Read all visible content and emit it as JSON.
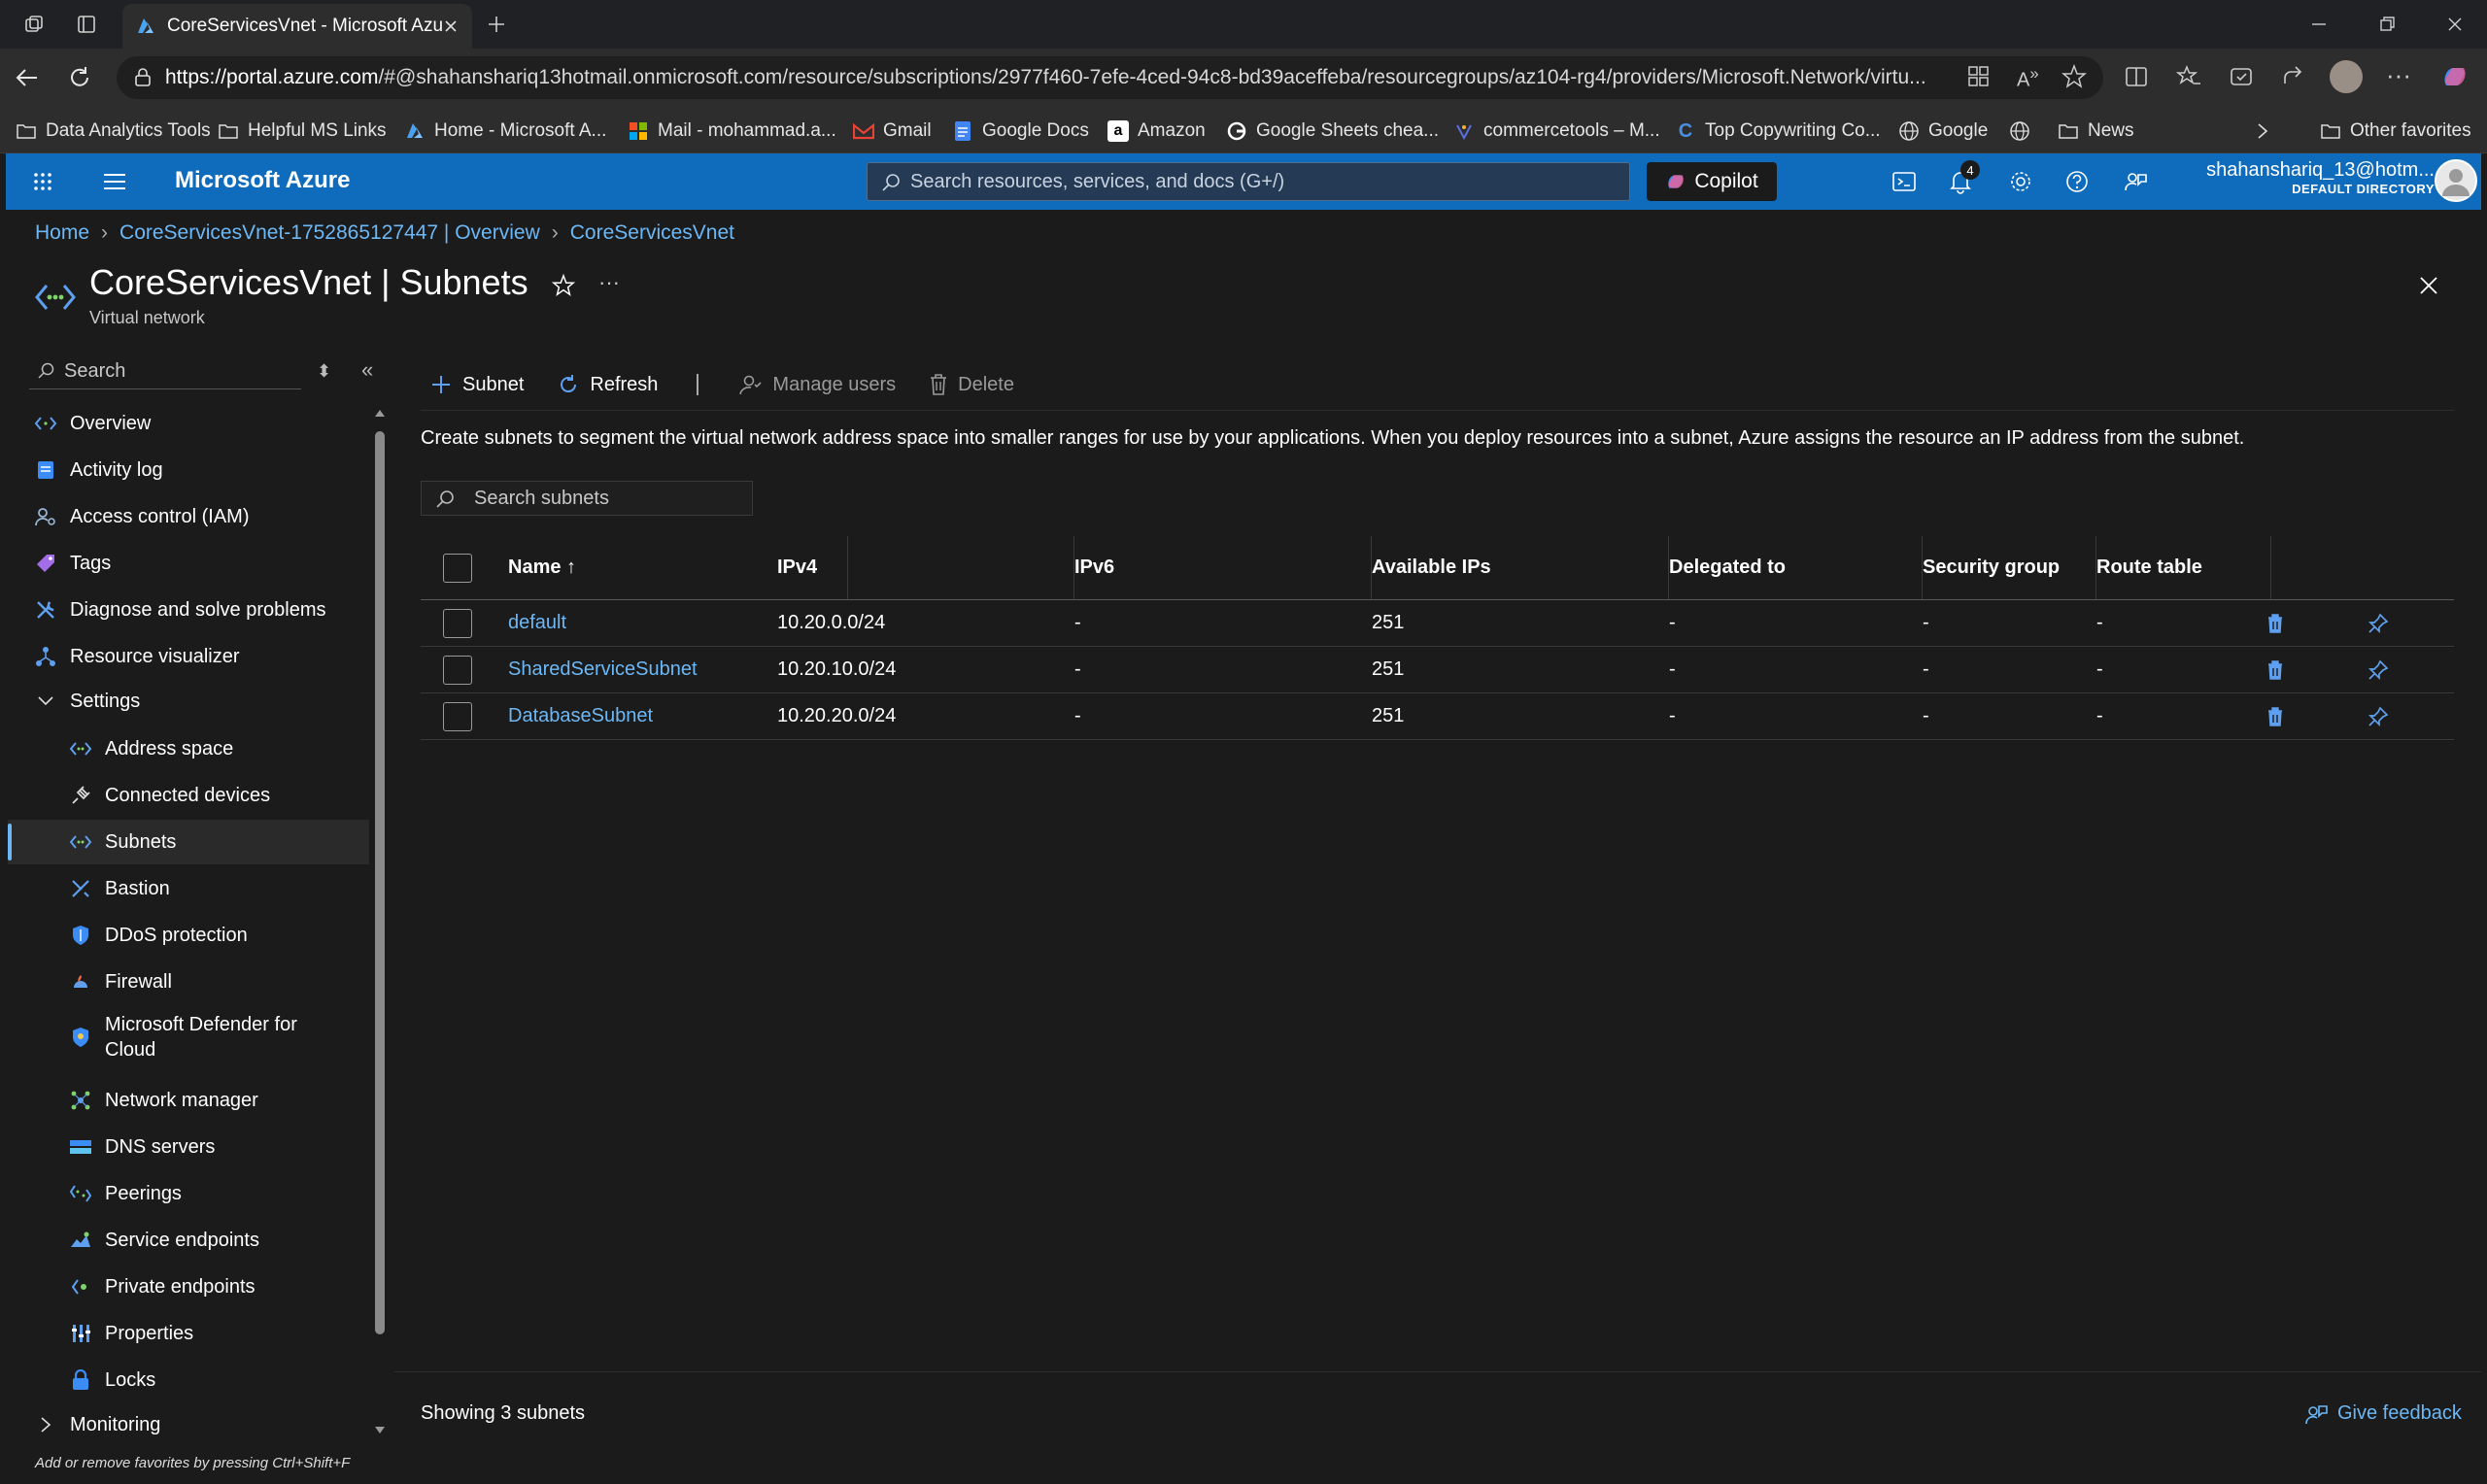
{
  "browser": {
    "tab_title": "CoreServicesVnet - Microsoft Azure",
    "url_host": "https://portal.azure.com",
    "url_rest": "/#@shahanshariq13hotmail.onmicrosoft.com/resource/subscriptions/2977f460-7efe-4ced-94c8-bd39aceffeba/resourcegroups/az104-rg4/providers/Microsoft.Network/virtu...",
    "bookmarks": [
      {
        "label": "Data Analytics Tools",
        "icon": "folder-icon"
      },
      {
        "label": "Helpful MS Links",
        "icon": "folder-icon"
      },
      {
        "label": "Home - Microsoft A...",
        "icon": "azure-icon"
      },
      {
        "label": "Mail - mohammad.a...",
        "icon": "microsoft-icon"
      },
      {
        "label": "Gmail",
        "icon": "gmail-icon"
      },
      {
        "label": "Google Docs",
        "icon": "docs-icon"
      },
      {
        "label": "Amazon",
        "icon": "amazon-icon"
      },
      {
        "label": "Google Sheets chea...",
        "icon": "google-icon"
      },
      {
        "label": "commercetools – M...",
        "icon": "commercetools-icon"
      },
      {
        "label": "Top Copywriting Co...",
        "icon": "copywriting-icon"
      },
      {
        "label": "Google",
        "icon": "globe-icon"
      },
      {
        "label": "",
        "icon": "globe-icon"
      },
      {
        "label": "News",
        "icon": "folder-icon"
      }
    ],
    "other_favorites": "Other favorites"
  },
  "azure": {
    "brand": "Microsoft Azure",
    "search_placeholder": "Search resources, services, and docs (G+/)",
    "copilot": "Copilot",
    "notification_count": "4",
    "user_email": "shahanshariq_13@hotm...",
    "directory": "DEFAULT DIRECTORY"
  },
  "breadcrumb": [
    "Home",
    "CoreServicesVnet-1752865127447 | Overview",
    "CoreServicesVnet"
  ],
  "page": {
    "title": "CoreServicesVnet | Subnets",
    "subtitle": "Virtual network"
  },
  "sidebar": {
    "search_placeholder": "Search",
    "items": [
      {
        "label": "Overview",
        "icon": "overview-icon",
        "level": 1
      },
      {
        "label": "Activity log",
        "icon": "activity-log-icon",
        "level": 1
      },
      {
        "label": "Access control (IAM)",
        "icon": "iam-icon",
        "level": 1
      },
      {
        "label": "Tags",
        "icon": "tag-icon",
        "level": 1
      },
      {
        "label": "Diagnose and solve problems",
        "icon": "wrench-icon",
        "level": 1
      },
      {
        "label": "Resource visualizer",
        "icon": "visualizer-icon",
        "level": 1
      },
      {
        "label": "Settings",
        "icon": "chevron-down-icon",
        "level": 1
      },
      {
        "label": "Address space",
        "icon": "vnet-icon",
        "level": 2
      },
      {
        "label": "Connected devices",
        "icon": "plug-icon",
        "level": 2
      },
      {
        "label": "Subnets",
        "icon": "vnet-icon",
        "level": 2
      },
      {
        "label": "Bastion",
        "icon": "bastion-icon",
        "level": 2
      },
      {
        "label": "DDoS protection",
        "icon": "shield-icon",
        "level": 2
      },
      {
        "label": "Firewall",
        "icon": "firewall-icon",
        "level": 2
      },
      {
        "label": "Microsoft Defender for Cloud",
        "icon": "defender-icon",
        "level": 2
      },
      {
        "label": "Network manager",
        "icon": "network-manager-icon",
        "level": 2
      },
      {
        "label": "DNS servers",
        "icon": "dns-icon",
        "level": 2
      },
      {
        "label": "Peerings",
        "icon": "peering-icon",
        "level": 2
      },
      {
        "label": "Service endpoints",
        "icon": "service-endpoint-icon",
        "level": 2
      },
      {
        "label": "Private endpoints",
        "icon": "private-endpoint-icon",
        "level": 2
      },
      {
        "label": "Properties",
        "icon": "properties-icon",
        "level": 2
      },
      {
        "label": "Locks",
        "icon": "lock-icon",
        "level": 2
      },
      {
        "label": "Monitoring",
        "icon": "chevron-right-icon",
        "level": 1
      }
    ],
    "selected": "Subnets",
    "hint": "Add or remove favorites by pressing Ctrl+Shift+F"
  },
  "toolbar": {
    "subnet": "Subnet",
    "refresh": "Refresh",
    "manage_users": "Manage users",
    "delete": "Delete"
  },
  "description": "Create subnets to segment the virtual network address space into smaller ranges for use by your applications. When you deploy resources into a subnet, Azure assigns the resource an IP address from the subnet.",
  "subnet_search_placeholder": "Search subnets",
  "table": {
    "columns": [
      "Name ↑",
      "IPv4",
      "IPv6",
      "Available IPs",
      "Delegated to",
      "Security group",
      "Route table"
    ],
    "rows": [
      {
        "name": "default",
        "ipv4": "10.20.0.0/24",
        "ipv6": "-",
        "available": "251",
        "delegated": "-",
        "nsg": "-",
        "route": "-"
      },
      {
        "name": "SharedServiceSubnet",
        "ipv4": "10.20.10.0/24",
        "ipv6": "-",
        "available": "251",
        "delegated": "-",
        "nsg": "-",
        "route": "-"
      },
      {
        "name": "DatabaseSubnet",
        "ipv4": "10.20.20.0/24",
        "ipv6": "-",
        "available": "251",
        "delegated": "-",
        "nsg": "-",
        "route": "-"
      }
    ]
  },
  "footer": {
    "showing": "Showing 3 subnets",
    "feedback": "Give feedback"
  }
}
